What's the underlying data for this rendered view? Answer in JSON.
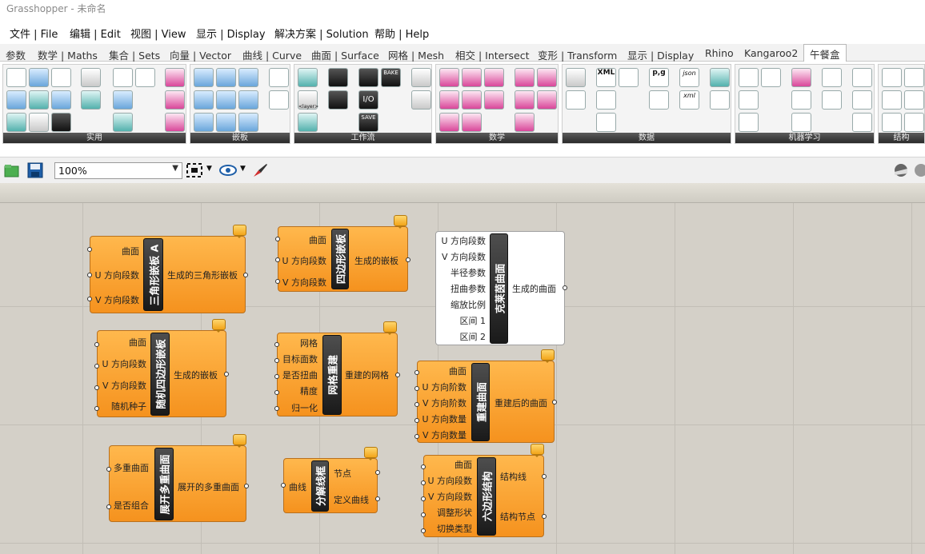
{
  "window": {
    "title": "Grasshopper - 未命名"
  },
  "menu": [
    "文件 | File",
    "编辑 | Edit",
    "视图 | View",
    "显示 | Display",
    "解决方案 | Solution",
    "帮助 | Help"
  ],
  "tabs": [
    "参数",
    "数学 | Maths",
    "集合 | Sets",
    "向量 | Vector",
    "曲线 | Curve",
    "曲面 | Surface",
    "网格 | Mesh",
    "相交 | Intersect",
    "变形 | Transform",
    "显示 | Display",
    "Rhino",
    "Kangaroo2",
    "午餐盒"
  ],
  "active_tab": "午餐盒",
  "ribbon": {
    "panels": [
      "实用",
      "嵌板",
      "工作流",
      "数学",
      "数据",
      "机器学习",
      "结构"
    ],
    "text_icons": {
      "bake": "BAKE",
      "save": "SAVE",
      "layer": "<layer>",
      "io": "I/O",
      "xml": "XML",
      "pg": "p,g",
      "json": "json",
      "xml2": "xml"
    }
  },
  "toolbar": {
    "zoom": "100%"
  },
  "nodes": {
    "tri": {
      "title": "三角形嵌板 A",
      "inputs": [
        "曲面",
        "U 方向段数",
        "V 方向段数"
      ],
      "outputs": [
        "生成的三角形嵌板"
      ]
    },
    "quad": {
      "title": "四边形嵌板",
      "inputs": [
        "曲面",
        "U 方向段数",
        "V 方向段数"
      ],
      "outputs": [
        "生成的嵌板"
      ]
    },
    "klein": {
      "title": "克莱茵曲面",
      "inputs": [
        "U 方向段数",
        "V 方向段数",
        "半径参数",
        "扭曲参数",
        "缩放比例",
        "区间 1",
        "区间 2"
      ],
      "outputs": [
        "生成的曲面"
      ]
    },
    "randquad": {
      "title": "随机四边形嵌板",
      "inputs": [
        "曲面",
        "U 方向段数",
        "V 方向段数",
        "随机种子"
      ],
      "outputs": [
        "生成的嵌板"
      ]
    },
    "remesh": {
      "title": "网格重建",
      "inputs": [
        "网格",
        "目标面数",
        "是否扭曲",
        "精度",
        "归一化"
      ],
      "outputs": [
        "重建的网格"
      ]
    },
    "rebuild": {
      "title": "重建曲面",
      "inputs": [
        "曲面",
        "U 方向阶数",
        "V 方向阶数",
        "U 方向数量",
        "V 方向数量"
      ],
      "outputs": [
        "重建后的曲面"
      ]
    },
    "explode": {
      "title": "展开多重曲面",
      "inputs": [
        "多重曲面",
        "是否组合"
      ],
      "outputs": [
        "展开的多重曲面"
      ]
    },
    "wire": {
      "title": "分解线框",
      "inputs": [
        "曲线"
      ],
      "outputs": [
        "节点",
        "定义曲线"
      ]
    },
    "hex": {
      "title": "六边形结构",
      "inputs": [
        "曲面",
        "U 方向段数",
        "V 方向段数",
        "调整形状",
        "切换类型"
      ],
      "outputs": [
        "结构线",
        "结构节点"
      ]
    }
  },
  "colors": {
    "node_fill": "#f7a035",
    "caption": "#1f1f1f",
    "canvas": "#d4d0c8"
  }
}
